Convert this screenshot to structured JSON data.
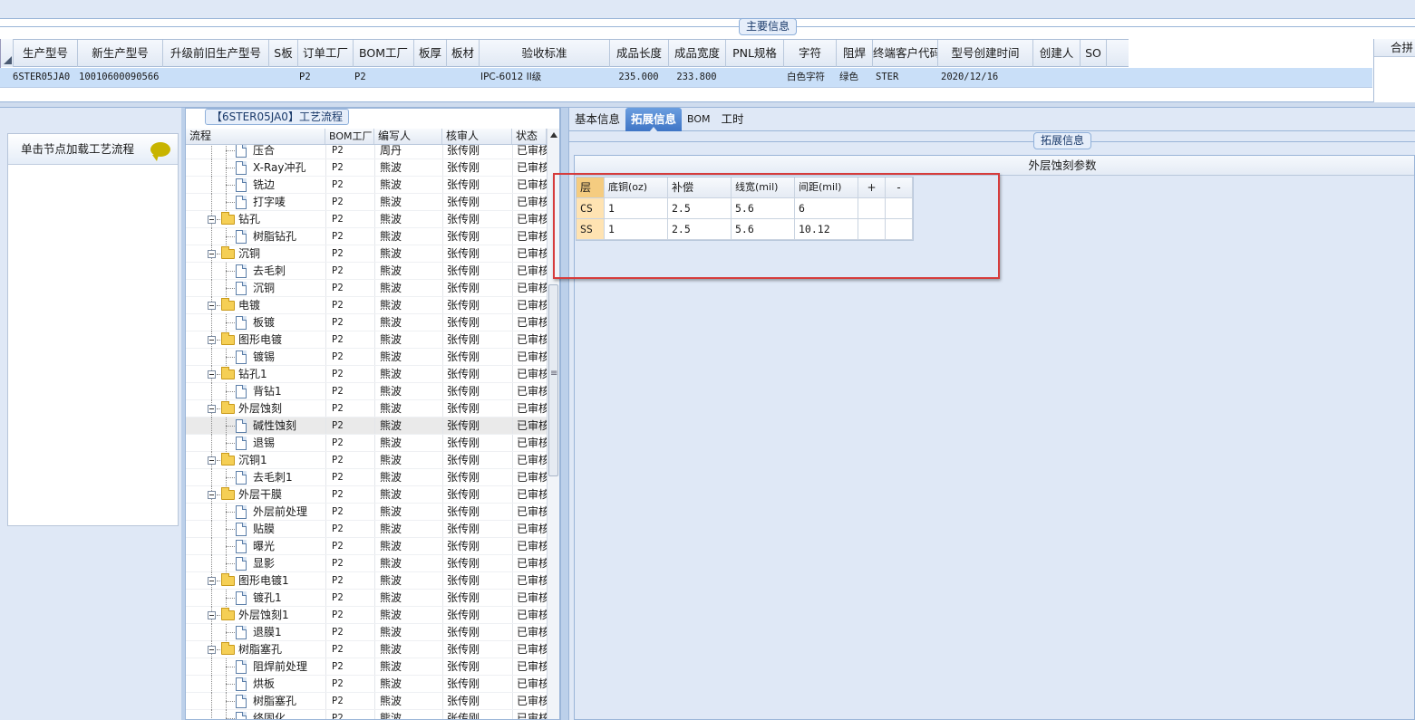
{
  "main_info": {
    "section_title": "主要信息",
    "columns": [
      "生产型号",
      "新生产型号",
      "升级前旧生产型号",
      "S板",
      "订单工厂",
      "BOM工厂",
      "板厚",
      "板材",
      "验收标准",
      "成品长度",
      "成品宽度",
      "PNL规格",
      "字符",
      "阻焊",
      "终端客户代码",
      "型号创建时间",
      "创建人",
      "SO"
    ],
    "row": [
      "6STER05JA0",
      "10010600090566",
      "",
      "",
      "P2",
      "P2",
      "",
      "",
      "IPC-6012 II级",
      "235.000",
      "233.800",
      "",
      "白色字符",
      "绿色",
      "STER",
      "2020/12/16",
      "",
      ""
    ],
    "right_header": "合拼"
  },
  "left_pane": {
    "node_hint": "单击节点加载工艺流程"
  },
  "process": {
    "title": "【6STER05JA0】工艺流程",
    "columns": [
      "流程",
      "BOM工厂",
      "编写人",
      "核审人",
      "状态"
    ],
    "rows": [
      {
        "name": "压合",
        "level": 2,
        "folder": false,
        "bom": "P2",
        "writer": "周丹",
        "reviewer": "张传刚",
        "status": "已审核"
      },
      {
        "name": "X-Ray冲孔",
        "level": 2,
        "folder": false,
        "bom": "P2",
        "writer": "熊波",
        "reviewer": "张传刚",
        "status": "已审核"
      },
      {
        "name": "铣边",
        "level": 2,
        "folder": false,
        "bom": "P2",
        "writer": "熊波",
        "reviewer": "张传刚",
        "status": "已审核"
      },
      {
        "name": "打字唛",
        "level": 2,
        "folder": false,
        "bom": "P2",
        "writer": "熊波",
        "reviewer": "张传刚",
        "status": "已审核"
      },
      {
        "name": "钻孔",
        "level": 1,
        "folder": true,
        "bom": "P2",
        "writer": "熊波",
        "reviewer": "张传刚",
        "status": "已审核"
      },
      {
        "name": "树脂钻孔",
        "level": 2,
        "folder": false,
        "bom": "P2",
        "writer": "熊波",
        "reviewer": "张传刚",
        "status": "已审核"
      },
      {
        "name": "沉铜",
        "level": 1,
        "folder": true,
        "bom": "P2",
        "writer": "熊波",
        "reviewer": "张传刚",
        "status": "已审核"
      },
      {
        "name": "去毛刺",
        "level": 2,
        "folder": false,
        "bom": "P2",
        "writer": "熊波",
        "reviewer": "张传刚",
        "status": "已审核"
      },
      {
        "name": "沉铜",
        "level": 2,
        "folder": false,
        "bom": "P2",
        "writer": "熊波",
        "reviewer": "张传刚",
        "status": "已审核"
      },
      {
        "name": "电镀",
        "level": 1,
        "folder": true,
        "bom": "P2",
        "writer": "熊波",
        "reviewer": "张传刚",
        "status": "已审核"
      },
      {
        "name": "板镀",
        "level": 2,
        "folder": false,
        "bom": "P2",
        "writer": "熊波",
        "reviewer": "张传刚",
        "status": "已审核"
      },
      {
        "name": "图形电镀",
        "level": 1,
        "folder": true,
        "bom": "P2",
        "writer": "熊波",
        "reviewer": "张传刚",
        "status": "已审核"
      },
      {
        "name": "镀锡",
        "level": 2,
        "folder": false,
        "bom": "P2",
        "writer": "熊波",
        "reviewer": "张传刚",
        "status": "已审核"
      },
      {
        "name": "钻孔1",
        "level": 1,
        "folder": true,
        "bom": "P2",
        "writer": "熊波",
        "reviewer": "张传刚",
        "status": "已审核"
      },
      {
        "name": "背钻1",
        "level": 2,
        "folder": false,
        "bom": "P2",
        "writer": "熊波",
        "reviewer": "张传刚",
        "status": "已审核"
      },
      {
        "name": "外层蚀刻",
        "level": 1,
        "folder": true,
        "bom": "P2",
        "writer": "熊波",
        "reviewer": "张传刚",
        "status": "已审核"
      },
      {
        "name": "碱性蚀刻",
        "level": 2,
        "folder": false,
        "bom": "P2",
        "writer": "熊波",
        "reviewer": "张传刚",
        "status": "已审核",
        "selected": true
      },
      {
        "name": "退锡",
        "level": 2,
        "folder": false,
        "bom": "P2",
        "writer": "熊波",
        "reviewer": "张传刚",
        "status": "已审核"
      },
      {
        "name": "沉铜1",
        "level": 1,
        "folder": true,
        "bom": "P2",
        "writer": "熊波",
        "reviewer": "张传刚",
        "status": "已审核"
      },
      {
        "name": "去毛刺1",
        "level": 2,
        "folder": false,
        "bom": "P2",
        "writer": "熊波",
        "reviewer": "张传刚",
        "status": "已审核"
      },
      {
        "name": "外层干膜",
        "level": 1,
        "folder": true,
        "bom": "P2",
        "writer": "熊波",
        "reviewer": "张传刚",
        "status": "已审核"
      },
      {
        "name": "外层前处理",
        "level": 2,
        "folder": false,
        "bom": "P2",
        "writer": "熊波",
        "reviewer": "张传刚",
        "status": "已审核"
      },
      {
        "name": "贴膜",
        "level": 2,
        "folder": false,
        "bom": "P2",
        "writer": "熊波",
        "reviewer": "张传刚",
        "status": "已审核"
      },
      {
        "name": "曝光",
        "level": 2,
        "folder": false,
        "bom": "P2",
        "writer": "熊波",
        "reviewer": "张传刚",
        "status": "已审核"
      },
      {
        "name": "显影",
        "level": 2,
        "folder": false,
        "bom": "P2",
        "writer": "熊波",
        "reviewer": "张传刚",
        "status": "已审核"
      },
      {
        "name": "图形电镀1",
        "level": 1,
        "folder": true,
        "bom": "P2",
        "writer": "熊波",
        "reviewer": "张传刚",
        "status": "已审核"
      },
      {
        "name": "镀孔1",
        "level": 2,
        "folder": false,
        "bom": "P2",
        "writer": "熊波",
        "reviewer": "张传刚",
        "status": "已审核"
      },
      {
        "name": "外层蚀刻1",
        "level": 1,
        "folder": true,
        "bom": "P2",
        "writer": "熊波",
        "reviewer": "张传刚",
        "status": "已审核"
      },
      {
        "name": "退膜1",
        "level": 2,
        "folder": false,
        "bom": "P2",
        "writer": "熊波",
        "reviewer": "张传刚",
        "status": "已审核"
      },
      {
        "name": "树脂塞孔",
        "level": 1,
        "folder": true,
        "bom": "P2",
        "writer": "熊波",
        "reviewer": "张传刚",
        "status": "已审核"
      },
      {
        "name": "阻焊前处理",
        "level": 2,
        "folder": false,
        "bom": "P2",
        "writer": "熊波",
        "reviewer": "张传刚",
        "status": "已审核"
      },
      {
        "name": "烘板",
        "level": 2,
        "folder": false,
        "bom": "P2",
        "writer": "熊波",
        "reviewer": "张传刚",
        "status": "已审核"
      },
      {
        "name": "树脂塞孔",
        "level": 2,
        "folder": false,
        "bom": "P2",
        "writer": "熊波",
        "reviewer": "张传刚",
        "status": "已审核"
      },
      {
        "name": "终固化",
        "level": 2,
        "folder": false,
        "bom": "P2",
        "writer": "熊波",
        "reviewer": "张传刚",
        "status": "已审核"
      }
    ]
  },
  "tabs": {
    "basic": "基本信息",
    "extended": "拓展信息",
    "bom": "BOM",
    "hours": "工时",
    "active": "extended"
  },
  "extended": {
    "section_title": "拓展信息",
    "panel_title": "外层蚀刻参数",
    "table": {
      "headers": [
        "层",
        "底铜(oz)",
        "补偿",
        "线宽(mil)",
        "间距(mil)",
        "+",
        "-"
      ],
      "rows": [
        [
          "CS",
          "1",
          "2.5",
          "5.6",
          "6",
          "",
          ""
        ],
        [
          "SS",
          "1",
          "2.5",
          "5.6",
          "10.12",
          "",
          ""
        ]
      ]
    }
  },
  "colors": {
    "selected_row": "#c9dff8",
    "active_tab": "#3f75c6",
    "highlight_box": "#d63c3c",
    "layer_cell": "#ffe3b2"
  }
}
